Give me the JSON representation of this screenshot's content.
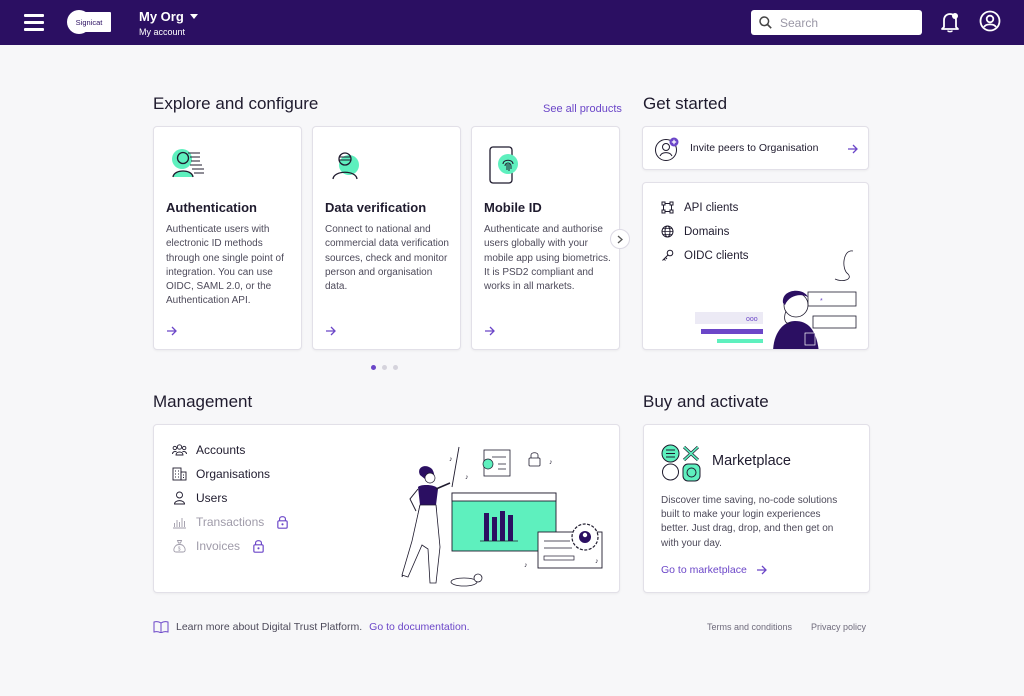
{
  "header": {
    "logo_text": "Signicat",
    "org_name": "My Org",
    "org_sub": "My account",
    "search_placeholder": "Search"
  },
  "explore": {
    "title": "Explore and configure",
    "see_all": "See all products",
    "products": [
      {
        "title": "Authentication",
        "desc": "Authenticate users with electronic ID methods through one single point of integration. You can use OIDC, SAML 2.0, or the Authentication API."
      },
      {
        "title": "Data verification",
        "desc": "Connect to national and commercial data verification sources, check and monitor person and organisation data."
      },
      {
        "title": "Mobile ID",
        "desc": "Authenticate and authorise users globally with your mobile app using biometrics. It is PSD2 compliant and works in all markets."
      }
    ],
    "active_dot": 1,
    "dot_count": 3
  },
  "get_started": {
    "title": "Get started",
    "invite_label": "Invite peers to Organisation",
    "links": [
      "API clients",
      "Domains",
      "OIDC clients"
    ]
  },
  "management": {
    "title": "Management",
    "items": [
      {
        "label": "Accounts",
        "enabled": true
      },
      {
        "label": "Organisations",
        "enabled": true
      },
      {
        "label": "Users",
        "enabled": true
      },
      {
        "label": "Transactions",
        "enabled": false
      },
      {
        "label": "Invoices",
        "enabled": false
      }
    ]
  },
  "buy": {
    "title": "Buy and activate",
    "card_title": "Marketplace",
    "desc": "Discover time saving, no-code solutions built to make your login experiences better. Just drag, drop, and then get on with your day.",
    "link": "Go to marketplace"
  },
  "footer": {
    "learn_text": "Learn more about Digital Trust Platform.",
    "doc_link": "Go to documentation.",
    "terms": "Terms and conditions",
    "privacy": "Privacy policy"
  },
  "colors": {
    "header_bg": "#2b0f62",
    "accent": "#6b46c8",
    "mint": "#5ef0be"
  }
}
